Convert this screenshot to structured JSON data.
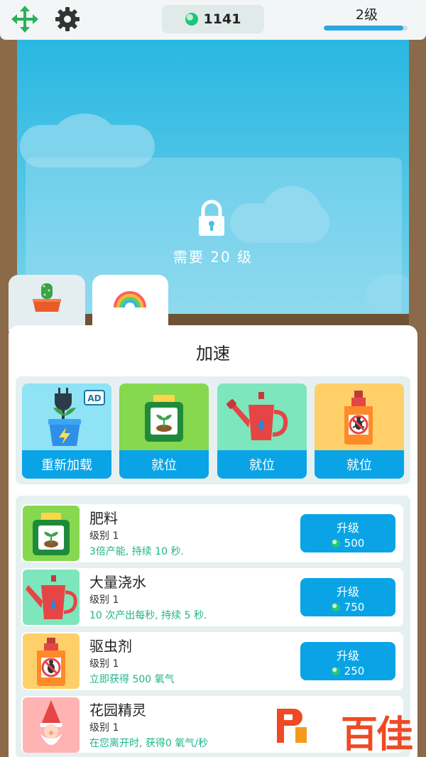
{
  "header": {
    "coins": "1141",
    "level": "2级",
    "level_progress": 0.95
  },
  "icons": {
    "move": "move-arrows-icon",
    "settings": "gear-icon",
    "coin": "coin-icon",
    "lock": "lock-icon"
  },
  "locked_area": {
    "text": "需要 20 级"
  },
  "tabs": [
    {
      "id": "plants",
      "icon": "cactus-pot-icon"
    },
    {
      "id": "boosts",
      "icon": "rainbow-icon",
      "active": true
    }
  ],
  "panel": {
    "title": "加速"
  },
  "boosts": [
    {
      "art": "plant-plug-ad-icon",
      "button": "重新加载",
      "bg": "#8fe3f5"
    },
    {
      "art": "fertilizer-icon",
      "button": "就位",
      "bg": "#86d84f"
    },
    {
      "art": "watering-can-icon",
      "button": "就位",
      "bg": "#7de6bd"
    },
    {
      "art": "bug-spray-icon",
      "button": "就位",
      "bg": "#ffd06a"
    }
  ],
  "upgrades": [
    {
      "name": "肥料",
      "level": "级别 1",
      "desc": "3倍产能, 持续 10 秒.",
      "button": "升级",
      "cost": "500",
      "art": "fertilizer-icon",
      "bg": "#86d84f"
    },
    {
      "name": "大量浇水",
      "level": "级别 1",
      "desc": "10 次产出每秒, 持续 5 秒.",
      "button": "升级",
      "cost": "750",
      "art": "watering-can-icon",
      "bg": "#7de6bd"
    },
    {
      "name": "驱虫剂",
      "level": "级别 1",
      "desc": "立即获得 500 氧气",
      "button": "升级",
      "cost": "250",
      "art": "bug-spray-icon",
      "bg": "#ffd06a"
    },
    {
      "name": "花园精灵",
      "level": "级别 1",
      "desc": "在您离开时, 获得0 氧气/秒",
      "art": "garden-gnome-icon",
      "bg": "#ffb3b3"
    }
  ],
  "watermark": {
    "text": "百佳"
  }
}
